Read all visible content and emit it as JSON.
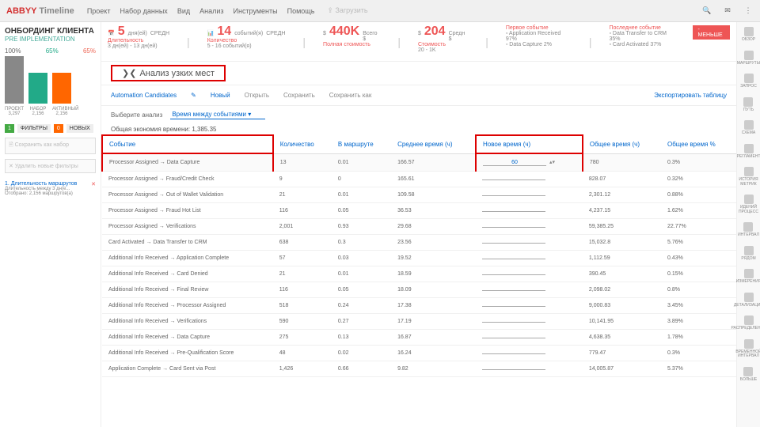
{
  "app": {
    "brand_red": "ABBYY",
    "brand_grey": "Timeline"
  },
  "menu": [
    "Проект",
    "Набор данных",
    "Вид",
    "Анализ",
    "Инструменты",
    "Помощь"
  ],
  "upload": "Загрузить",
  "project": {
    "title": "ОНБОРДИНГ КЛИЕНТА",
    "sub": "PRE IMPLEMENTATION",
    "pct": [
      "100%",
      "65%",
      "65%"
    ],
    "bar_labels": [
      [
        "ПРОЕКТ",
        "3,297"
      ],
      [
        "НАБОР",
        "2,156"
      ],
      [
        "АКТИВНЫЙ",
        "2,156"
      ]
    ],
    "filters_label": "ФИЛЬТРЫ",
    "filters_n": "1",
    "new_label": "НОВЫХ",
    "new_n": "0",
    "save_set": "Сохранить как набор",
    "del_filters": "Удалить новые фильтры",
    "f1": "1. Длительность маршрутов",
    "f1s": "Длительность между 3 дн(е...",
    "f1c": "Отобрано: 2,156 маршрутов(а)"
  },
  "kpi": {
    "dur_big": "5",
    "dur_unit": "дня(ей)",
    "dur_avg": "СРЕДН",
    "dur_lbl": "Длительность",
    "dur_rng": "3 дн(ей) - 13 дн(ей)",
    "evt_big": "14",
    "evt_unit": "событий(я)",
    "evt_avg": "СРЕДН",
    "evt_lbl": "Количество",
    "evt_rng": "5 - 16 событий(я)",
    "cost_big": "440K",
    "cost_unit": "Всего $",
    "cost_lbl": "Полная стоимость",
    "cost2_big": "204",
    "cost2_unit": "Средн $",
    "cost2_lbl": "Стоимость",
    "cost2_rng": "20 - 1K",
    "first_evt": "Первое событие",
    "first_items": [
      [
        "Application Received",
        "97%"
      ],
      [
        "Data Capture",
        "2%"
      ]
    ],
    "last_evt": "Последнее событие",
    "last_items": [
      [
        "Data Transfer to CRM",
        "35%"
      ],
      [
        "Card Activated",
        "37%"
      ]
    ],
    "less": "- МЕНЬШЕ"
  },
  "analysis": {
    "title": "Анализ узких мест",
    "chev": "❯❮"
  },
  "toolbar": {
    "ac": "Automation Candidates",
    "new": "Новый",
    "open": "Открыть",
    "save": "Сохранить",
    "saveas": "Сохранить как",
    "export": "Экспортировать таблицу"
  },
  "sel": {
    "lbl": "Выберите анализ",
    "val": "Время между событиями"
  },
  "savings": "Общая экономия времени: 1,385.35",
  "cols": [
    "Событие",
    "Количество",
    "В маршруте",
    "Среднее время (ч)",
    "Новое время (ч)",
    "Общее время (ч)",
    "Общее время %"
  ],
  "rows": [
    [
      "Processor Assigned → Data Capture",
      "13",
      "0.01",
      "166.57",
      "60",
      "780",
      "0.3%"
    ],
    [
      "Processor Assigned → Fraud/Credit Check",
      "9",
      "0",
      "165.61",
      "",
      "828.07",
      "0.32%"
    ],
    [
      "Processor Assigned → Out of Wallet Validation",
      "21",
      "0.01",
      "109.58",
      "",
      "2,301.12",
      "0.88%"
    ],
    [
      "Processor Assigned → Fraud Hot List",
      "116",
      "0.05",
      "36.53",
      "",
      "4,237.15",
      "1.62%"
    ],
    [
      "Processor Assigned → Verifications",
      "2,001",
      "0.93",
      "29.68",
      "",
      "59,385.25",
      "22.77%"
    ],
    [
      "Card Activated → Data Transfer to CRM",
      "638",
      "0.3",
      "23.56",
      "",
      "15,032.8",
      "5.76%"
    ],
    [
      "Additional Info Received → Application Complete",
      "57",
      "0.03",
      "19.52",
      "",
      "1,112.59",
      "0.43%"
    ],
    [
      "Additional Info Received → Card Denied",
      "21",
      "0.01",
      "18.59",
      "",
      "390.45",
      "0.15%"
    ],
    [
      "Additional Info Received → Final Review",
      "116",
      "0.05",
      "18.09",
      "",
      "2,098.02",
      "0.8%"
    ],
    [
      "Additional Info Received → Processor Assigned",
      "518",
      "0.24",
      "17.38",
      "",
      "9,000.83",
      "3.45%"
    ],
    [
      "Additional Info Received → Verifications",
      "590",
      "0.27",
      "17.19",
      "",
      "10,141.95",
      "3.89%"
    ],
    [
      "Additional Info Received → Data Capture",
      "275",
      "0.13",
      "16.87",
      "",
      "4,638.35",
      "1.78%"
    ],
    [
      "Additional Info Received → Pre-Qualification Score",
      "48",
      "0.02",
      "16.24",
      "",
      "779.47",
      "0.3%"
    ],
    [
      "Application Complete → Card Sent via Post",
      "1,426",
      "0.66",
      "9.82",
      "",
      "14,005.87",
      "5.37%"
    ]
  ],
  "rnav": [
    "ОБЗОР",
    "МАРШРУТЫ",
    "ЗАПРОС",
    "ПУТЬ",
    "СХЕМА",
    "РЕГЛАМЕНТ",
    "ИСТОРИЯ МЕТРИК",
    "ИДЕНИЙ ПРОЦЕСС",
    "ИНТЕРВАЛ",
    "РЯДОМ",
    "ИЗМЕРЕНИЯ",
    "ДЕТАЛИЗАЦИЯ",
    "РАСПРЕДЕЛЕНИЕ",
    "ВРЕМЕННОЙ ИНТЕРВАЛ",
    "БОЛЬШЕ"
  ]
}
